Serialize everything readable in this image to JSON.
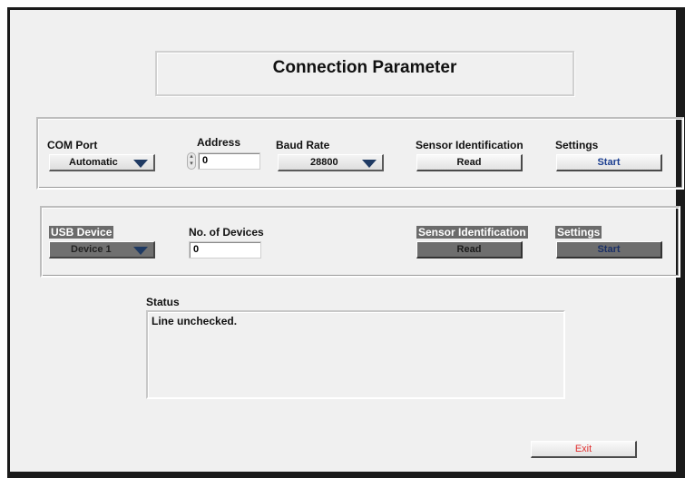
{
  "title": "Connection Parameter",
  "serial": {
    "com_port_label": "COM Port",
    "com_port_value": "Automatic",
    "address_label": "Address",
    "address_value": "0",
    "baud_rate_label": "Baud Rate",
    "baud_rate_value": "28800",
    "sensor_id_label": "Sensor Identification",
    "read_label": "Read",
    "settings_label": "Settings",
    "start_label": "Start"
  },
  "usb": {
    "usb_device_label": "USB Device",
    "usb_device_value": "Device 1",
    "num_devices_label": "No. of Devices",
    "num_devices_value": "0",
    "sensor_id_label": "Sensor Identification",
    "read_label": "Read",
    "settings_label": "Settings",
    "start_label": "Start"
  },
  "status": {
    "label": "Status",
    "text": "Line unchecked."
  },
  "exit_label": "Exit",
  "colors": {
    "arrow": "#1f3a63",
    "exit_text": "#e03030",
    "disabled_bg": "#6e6e6e"
  }
}
